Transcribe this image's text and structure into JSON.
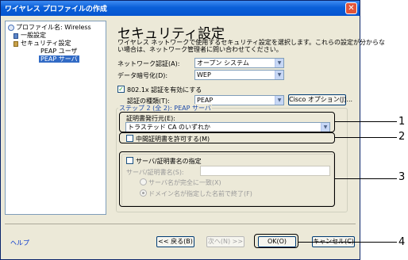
{
  "window": {
    "title": "ワイヤレス プロファイルの作成",
    "close_label": "✕"
  },
  "tree": {
    "items": [
      {
        "label": "プロファイル名: Wireless"
      },
      {
        "label": "一般設定"
      },
      {
        "label": "セキュリティ設定"
      },
      {
        "label": "PEAP ユーザ"
      },
      {
        "label": "PEAP サーバ"
      }
    ]
  },
  "main": {
    "title": "セキュリティ設定",
    "description_line1": "ワイヤレス ネットワークで使用するセキュリティ設定を選択します。これらの設定が分からな",
    "description_line2": "い場合は、ネットワーク管理者に問い合わせてください。",
    "auth_label": "ネットワーク認証(A):",
    "auth_value": "オープン システム",
    "encryption_label": "データ暗号化(D):",
    "encryption_value": "WEP",
    "enable_8021x_label": "802.1x 認証を有効にする",
    "auth_type_label": "認証の種類(T):",
    "auth_type_value": "PEAP",
    "cisco_options_label": "Cisco オプション(J)...",
    "step_legend": "ステップ 2 (全 2): PEAP サーバ",
    "cert_issuer_label": "証明書発行元(E):",
    "cert_issuer_value": "トラステッド CA のいずれか",
    "allow_intermediate_label": "中間証明書を許可する(M)",
    "specify_server_label": "サーバ/証明書名の指定",
    "server_name_label": "サーバ/証明書名(S):",
    "server_name_value": "",
    "exact_match_label": "サーバ名が完全に一致(X)",
    "domain_suffix_label": "ドメイン名が指定した名前で終了(F)"
  },
  "footer": {
    "help_label": "ヘルプ",
    "back_label": "<< 戻る(B)",
    "next_label": "次へ(N) >>",
    "ok_label": "OK(O)",
    "cancel_label": "キャンセル(C)"
  },
  "callouts": [
    "1",
    "2",
    "3",
    "4"
  ],
  "colors": {
    "titlebar": "#0a5fd8",
    "window_bg": "#ece9d8",
    "selection": "#316ac5",
    "group_legend": "#1e4ba8"
  }
}
